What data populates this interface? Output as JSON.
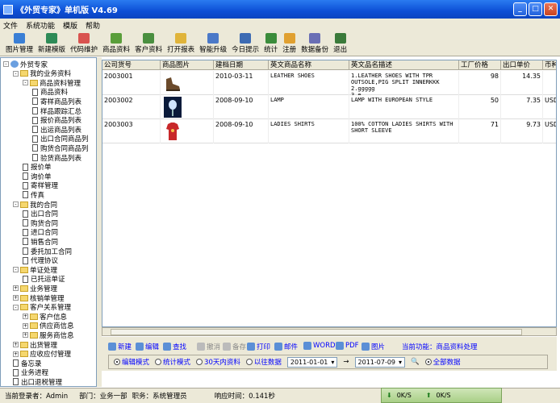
{
  "window": {
    "title": "《外贸专家》单机版 V4.69"
  },
  "menu": [
    "文件",
    "系统功能",
    "模版",
    "帮助"
  ],
  "toolbar": [
    {
      "label": "图片管理",
      "icon": "image-manage-icon",
      "color": "#3a7fd5"
    },
    {
      "label": "新建模版",
      "icon": "new-template-icon",
      "color": "#2e8b57"
    },
    {
      "label": "代码维护",
      "icon": "code-maintain-icon",
      "color": "#d9534f"
    },
    {
      "label": "商品资料",
      "icon": "product-data-icon",
      "color": "#5a9e3a"
    },
    {
      "label": "客户资料",
      "icon": "customer-data-icon",
      "color": "#4a8f3f"
    },
    {
      "label": "打开报表",
      "icon": "open-report-icon",
      "color": "#e0b43a"
    },
    {
      "label": "智能升级",
      "icon": "upgrade-icon",
      "color": "#4b79c8"
    },
    {
      "label": "今日提示",
      "icon": "today-tip-icon",
      "color": "#3d6bb3"
    },
    {
      "label": "统计",
      "icon": "statistics-icon",
      "color": "#3b8c3b"
    },
    {
      "label": "注册",
      "icon": "register-icon",
      "color": "#e0a030"
    },
    {
      "label": "数据备份",
      "icon": "backup-icon",
      "color": "#6a6fb5"
    },
    {
      "label": "退出",
      "icon": "exit-icon",
      "color": "#3a7a3a"
    }
  ],
  "tree": [
    {
      "label": "外贸专家",
      "level": 0,
      "type": "root",
      "pm": "-"
    },
    {
      "label": "我的业务资料",
      "level": 1,
      "type": "folder",
      "pm": "-"
    },
    {
      "label": "商品资料管理",
      "level": 2,
      "type": "folder",
      "pm": "-"
    },
    {
      "label": "商品资料",
      "level": 3,
      "type": "doc"
    },
    {
      "label": "寄样商品列表",
      "level": 3,
      "type": "doc"
    },
    {
      "label": "样品跟踪汇总",
      "level": 3,
      "type": "doc"
    },
    {
      "label": "报价商品列表",
      "level": 3,
      "type": "doc"
    },
    {
      "label": "出运商品列表",
      "level": 3,
      "type": "doc"
    },
    {
      "label": "出口合同商品列",
      "level": 3,
      "type": "doc"
    },
    {
      "label": "购货合同商品列",
      "level": 3,
      "type": "doc"
    },
    {
      "label": "验货商品列表",
      "level": 3,
      "type": "doc"
    },
    {
      "label": "报价单",
      "level": 2,
      "type": "doc"
    },
    {
      "label": "询价单",
      "level": 2,
      "type": "doc"
    },
    {
      "label": "寄样管理",
      "level": 2,
      "type": "doc"
    },
    {
      "label": "传真",
      "level": 2,
      "type": "doc"
    },
    {
      "label": "我的合同",
      "level": 1,
      "type": "folder",
      "pm": "-"
    },
    {
      "label": "出口合同",
      "level": 2,
      "type": "doc"
    },
    {
      "label": "购货合同",
      "level": 2,
      "type": "doc"
    },
    {
      "label": "进口合同",
      "level": 2,
      "type": "doc"
    },
    {
      "label": "销售合同",
      "level": 2,
      "type": "doc"
    },
    {
      "label": "委托加工合同",
      "level": 2,
      "type": "doc"
    },
    {
      "label": "代理协议",
      "level": 2,
      "type": "doc"
    },
    {
      "label": "单证处理",
      "level": 1,
      "type": "folder",
      "pm": "-"
    },
    {
      "label": "已托运单证",
      "level": 2,
      "type": "doc"
    },
    {
      "label": "业务管理",
      "level": 1,
      "type": "folder",
      "pm": "+"
    },
    {
      "label": "核销单管理",
      "level": 1,
      "type": "folder",
      "pm": "+"
    },
    {
      "label": "客户关系管理",
      "level": 1,
      "type": "folder",
      "pm": "-"
    },
    {
      "label": "客户信息",
      "level": 2,
      "type": "folder",
      "pm": "+"
    },
    {
      "label": "供应商信息",
      "level": 2,
      "type": "folder",
      "pm": "+"
    },
    {
      "label": "服务商信息",
      "level": 2,
      "type": "folder",
      "pm": "+"
    },
    {
      "label": "出货管理",
      "level": 1,
      "type": "folder",
      "pm": "+"
    },
    {
      "label": "应收应付管理",
      "level": 1,
      "type": "folder",
      "pm": "+"
    },
    {
      "label": "备忘录",
      "level": 1,
      "type": "doc"
    },
    {
      "label": "业务进程",
      "level": 1,
      "type": "doc"
    },
    {
      "label": "出口退税管理",
      "level": 1,
      "type": "doc"
    }
  ],
  "grid": {
    "columns": [
      "公司货号",
      "商品图片",
      "建档日期",
      "英文商品名称",
      "英文品名描述",
      "工厂价格",
      "出口单价",
      "币种"
    ],
    "rows": [
      {
        "code": "2003001",
        "image": "shoe-image",
        "date": "2010-03-11",
        "name": "LEATHER SHOES",
        "desc": [
          "1.LEATHER SHOES WITH TPR",
          "OUTSOLE,PIG SPLIT INNERKKK",
          "2.ggggg",
          "3.e..."
        ],
        "factory": "98",
        "price": "14.35",
        "currency": ""
      },
      {
        "code": "2003002",
        "image": "lamp-image",
        "date": "2008-09-10",
        "name": "LAMP",
        "desc": [
          "LAMP WITH EUROPEAN STYLE"
        ],
        "factory": "50",
        "price": "7.35",
        "currency": "USD"
      },
      {
        "code": "2003003",
        "image": "shirt-image",
        "date": "2008-09-10",
        "name": "LADIES SHIRTS",
        "desc": [
          "100% COTTON LADIES SHIRTS WITH",
          "SHORT SLEEVE"
        ],
        "factory": "71",
        "price": "9.73",
        "currency": "USD"
      }
    ]
  },
  "actions": [
    {
      "label": "新建",
      "icon": "new-icon",
      "enabled": true
    },
    {
      "label": "编辑",
      "icon": "edit-icon",
      "enabled": true
    },
    {
      "label": "查找",
      "icon": "find-icon",
      "enabled": true
    },
    {
      "label": "撤消",
      "icon": "undo-icon",
      "enabled": false
    },
    {
      "label": "备存",
      "icon": "save-icon",
      "enabled": false
    },
    {
      "label": "打印",
      "icon": "print-icon",
      "enabled": true
    },
    {
      "label": "邮件",
      "icon": "mail-icon",
      "enabled": true
    },
    {
      "label": "WORD",
      "icon": "word-icon",
      "enabled": true
    },
    {
      "label": "PDF",
      "icon": "pdf-icon",
      "enabled": true
    },
    {
      "label": "图片",
      "icon": "picture-icon",
      "enabled": true
    }
  ],
  "current_function": "当前功能：商品资料处理",
  "modes": {
    "edit_mode": "编辑模式",
    "stats_mode": "统计模式",
    "recent30": "30天内资料",
    "previous": "以往数据",
    "date_from": "2011-01-01",
    "date_sep": "→",
    "date_to": "2011-07-09",
    "all_data": "全部数据"
  },
  "status": {
    "user": "当前登录者：Admin",
    "dept": "部门：业务一部",
    "role": "职务：系统管理员",
    "response": "响应时间：0.141秒",
    "down": "0K/S",
    "up": "0K/S"
  }
}
